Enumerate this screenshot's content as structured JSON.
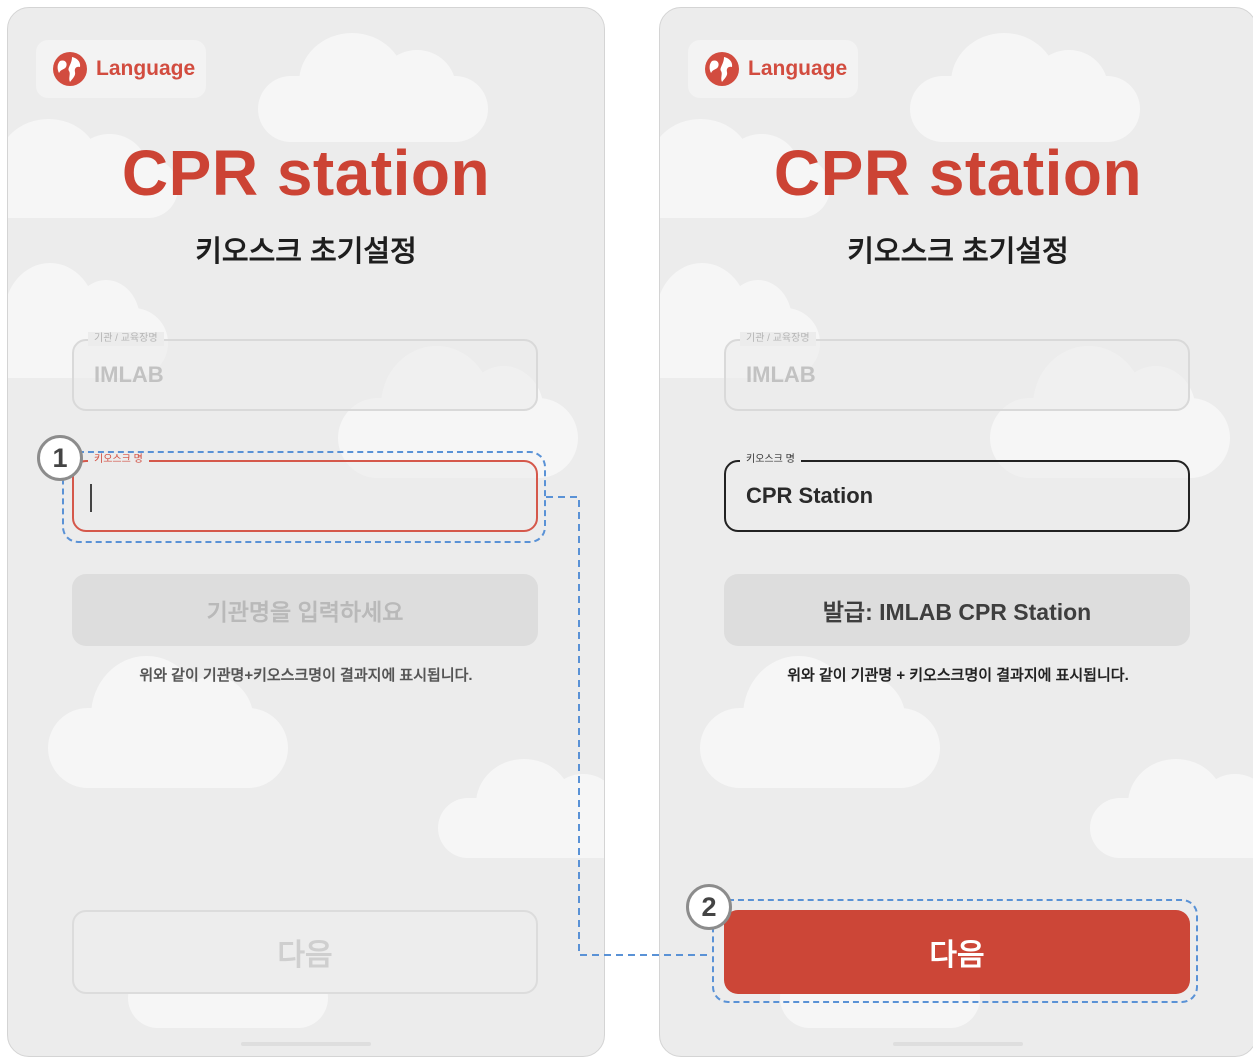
{
  "language_label": "Language",
  "app_title": "CPR station",
  "subtitle": "키오스크 초기설정",
  "org_field": {
    "legend": "기관 / 교육장명",
    "value": "IMLAB"
  },
  "kiosk_field": {
    "legend": "키오스크 명",
    "value_filled": "CPR Station"
  },
  "issue_placeholder": "기관명을 입력하세요",
  "issue_value": "발급: IMLAB CPR Station",
  "hint": "위와 같이 기관명+키오스크명이 결과지에 표시됩니다.",
  "hint_spaced": "위와 같이 기관명 + 키오스크명이 결과지에 표시됩니다.",
  "next_label": "다음",
  "step_badges": [
    "1",
    "2"
  ],
  "colors": {
    "brand_red": "#cc4334",
    "focus_red": "#d5584b",
    "annotation_blue": "#5a92d6",
    "background": "#ececec"
  },
  "icons": {
    "language": "globe-icon"
  }
}
